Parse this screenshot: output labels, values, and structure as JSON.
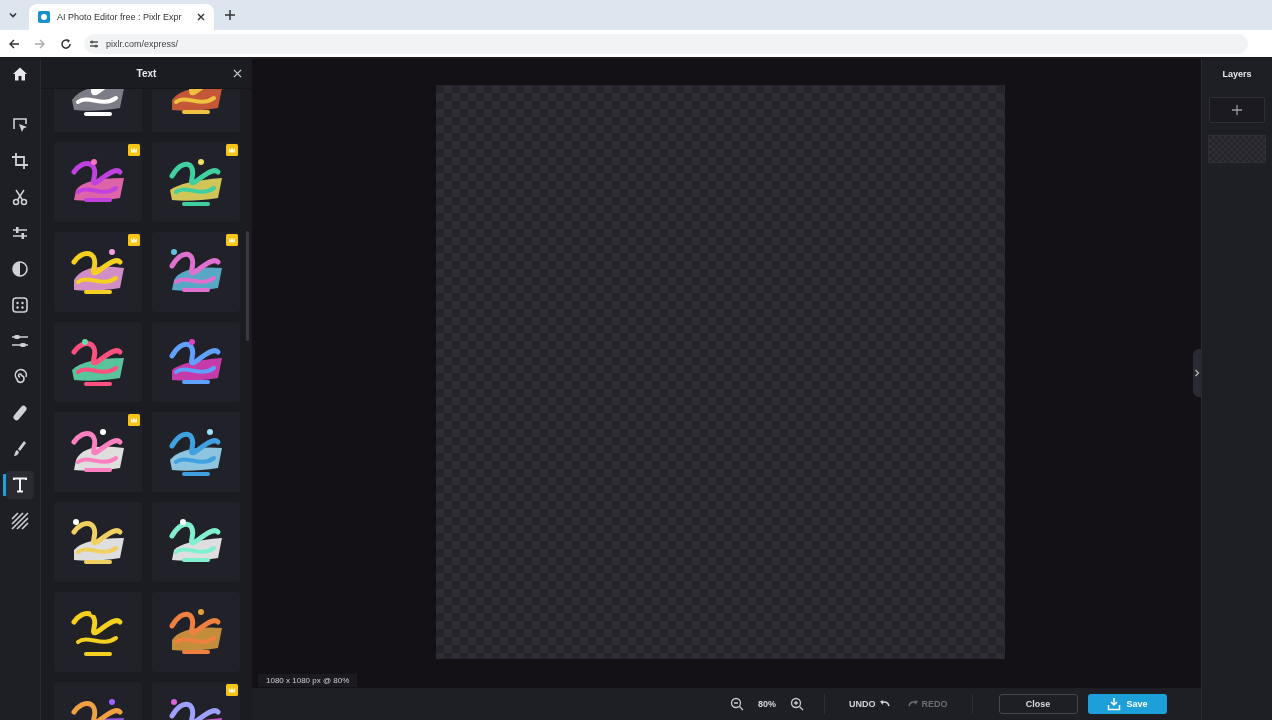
{
  "browser": {
    "tab": {
      "title": "AI Photo Editor free : Pixlr Expr"
    },
    "url": "pixlr.com/express/"
  },
  "tools": [
    {
      "kind": "select",
      "selected": false
    },
    {
      "kind": "crop",
      "selected": false
    },
    {
      "kind": "cut",
      "selected": false
    },
    {
      "kind": "adjust",
      "selected": false
    },
    {
      "kind": "filter",
      "selected": false
    },
    {
      "kind": "mosaic",
      "selected": false
    },
    {
      "kind": "effects",
      "selected": false
    },
    {
      "kind": "liquify",
      "selected": false
    },
    {
      "kind": "heal",
      "selected": false
    },
    {
      "kind": "brush",
      "selected": false
    },
    {
      "kind": "text",
      "selected": true
    },
    {
      "kind": "pattern",
      "selected": false
    }
  ],
  "panel": {
    "title": "Text",
    "stickers": [
      {
        "premium": false
      },
      {
        "premium": false
      },
      {
        "premium": true
      },
      {
        "premium": true
      },
      {
        "premium": true
      },
      {
        "premium": true
      },
      {
        "premium": false
      },
      {
        "premium": false
      },
      {
        "premium": true
      },
      {
        "premium": false
      },
      {
        "premium": false
      },
      {
        "premium": false
      },
      {
        "premium": false
      },
      {
        "premium": false
      },
      {
        "premium": false
      },
      {
        "premium": true
      }
    ]
  },
  "canvas": {
    "info": "1080 x 1080 px @ 80%"
  },
  "bottom_bar": {
    "zoom": "80%",
    "undo": {
      "label": "UNDO",
      "disabled": false
    },
    "redo": {
      "label": "REDO",
      "disabled": true
    },
    "close": "Close",
    "save": "Save"
  },
  "layers": {
    "title": "Layers"
  }
}
